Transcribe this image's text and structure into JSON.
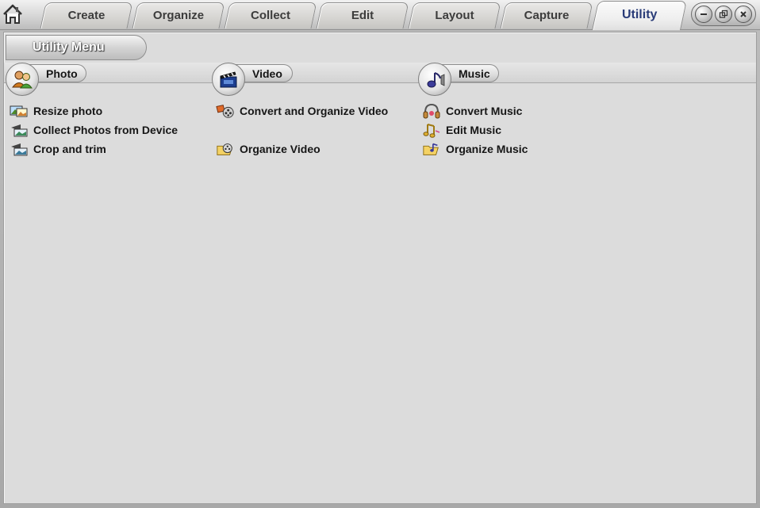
{
  "tabs": [
    {
      "label": "Create"
    },
    {
      "label": "Organize"
    },
    {
      "label": "Collect"
    },
    {
      "label": "Edit"
    },
    {
      "label": "Layout"
    },
    {
      "label": "Capture"
    },
    {
      "label": "Utility",
      "active": true
    }
  ],
  "window_controls": {
    "minimize_icon": "minimize-icon",
    "restore_icon": "restore-icon",
    "close_icon": "close-icon"
  },
  "menu": {
    "title": "Utility Menu"
  },
  "categories": {
    "photo": {
      "label": "Photo",
      "icon": "people-icon",
      "items": [
        {
          "label": "Resize photo",
          "icon": "resize-photo-icon"
        },
        {
          "label": "Collect Photos from Device",
          "icon": "camera-transfer-icon"
        },
        {
          "label": "Crop and trim",
          "icon": "crop-icon"
        }
      ]
    },
    "video": {
      "label": "Video",
      "icon": "clapperboard-icon",
      "items": [
        {
          "label": "Convert and Organize Video",
          "icon": "film-reel-convert-icon"
        },
        {
          "label": "Organize Video",
          "icon": "film-folder-icon"
        }
      ]
    },
    "music": {
      "label": "Music",
      "icon": "speaker-note-icon",
      "items": [
        {
          "label": "Convert Music",
          "icon": "headphones-icon"
        },
        {
          "label": "Edit Music",
          "icon": "music-notes-icon"
        },
        {
          "label": "Organize Music",
          "icon": "music-folder-icon"
        }
      ]
    }
  },
  "colors": {
    "active_tab_text": "#2a3c78",
    "panel_bg": "#dcdcdc"
  }
}
